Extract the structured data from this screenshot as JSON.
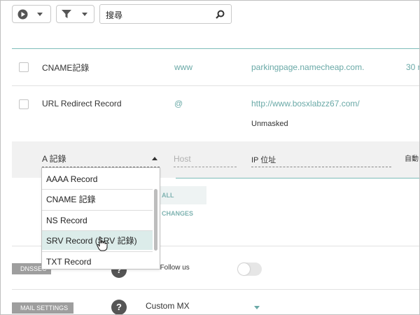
{
  "toolbar": {
    "play_icon": "play-circle-icon",
    "filter_icon": "filter-icon",
    "search_value": "搜尋",
    "search_icon": "magnifier-icon"
  },
  "records": [
    {
      "type": "CNAME記錄",
      "host": "www",
      "value": "parkingpage.namecheap.com.",
      "ttl": "30 r"
    },
    {
      "type": "URL Redirect Record",
      "host": "@",
      "value": "http://www.bosxlabzz67.com/",
      "extra": "Unmasked"
    }
  ],
  "edit_row": {
    "type_selected": "A 記錄",
    "host_placeholder": "Host",
    "ip_label": "IP 位址",
    "auto_label": "自動"
  },
  "save_changes_label": "ALL CHANGES",
  "dropdown": {
    "options": [
      "AAAA Record",
      "CNAME 記錄",
      "NS Record",
      "SRV Record (SRV 記錄)",
      "TXT Record"
    ],
    "highlighted": "SRV Record (SRV 記錄)"
  },
  "dnssec": {
    "tag": "DNSSEC",
    "help": "?",
    "label": "Stat Follow us",
    "toggle_state": "off"
  },
  "mail": {
    "tag": "MAIL SETTINGS",
    "help": "?",
    "selected": "Custom MX"
  },
  "colors": {
    "accent": "#6aa9a7",
    "teal_rule": "#7dbdb9",
    "highlight": "#dcecea"
  }
}
